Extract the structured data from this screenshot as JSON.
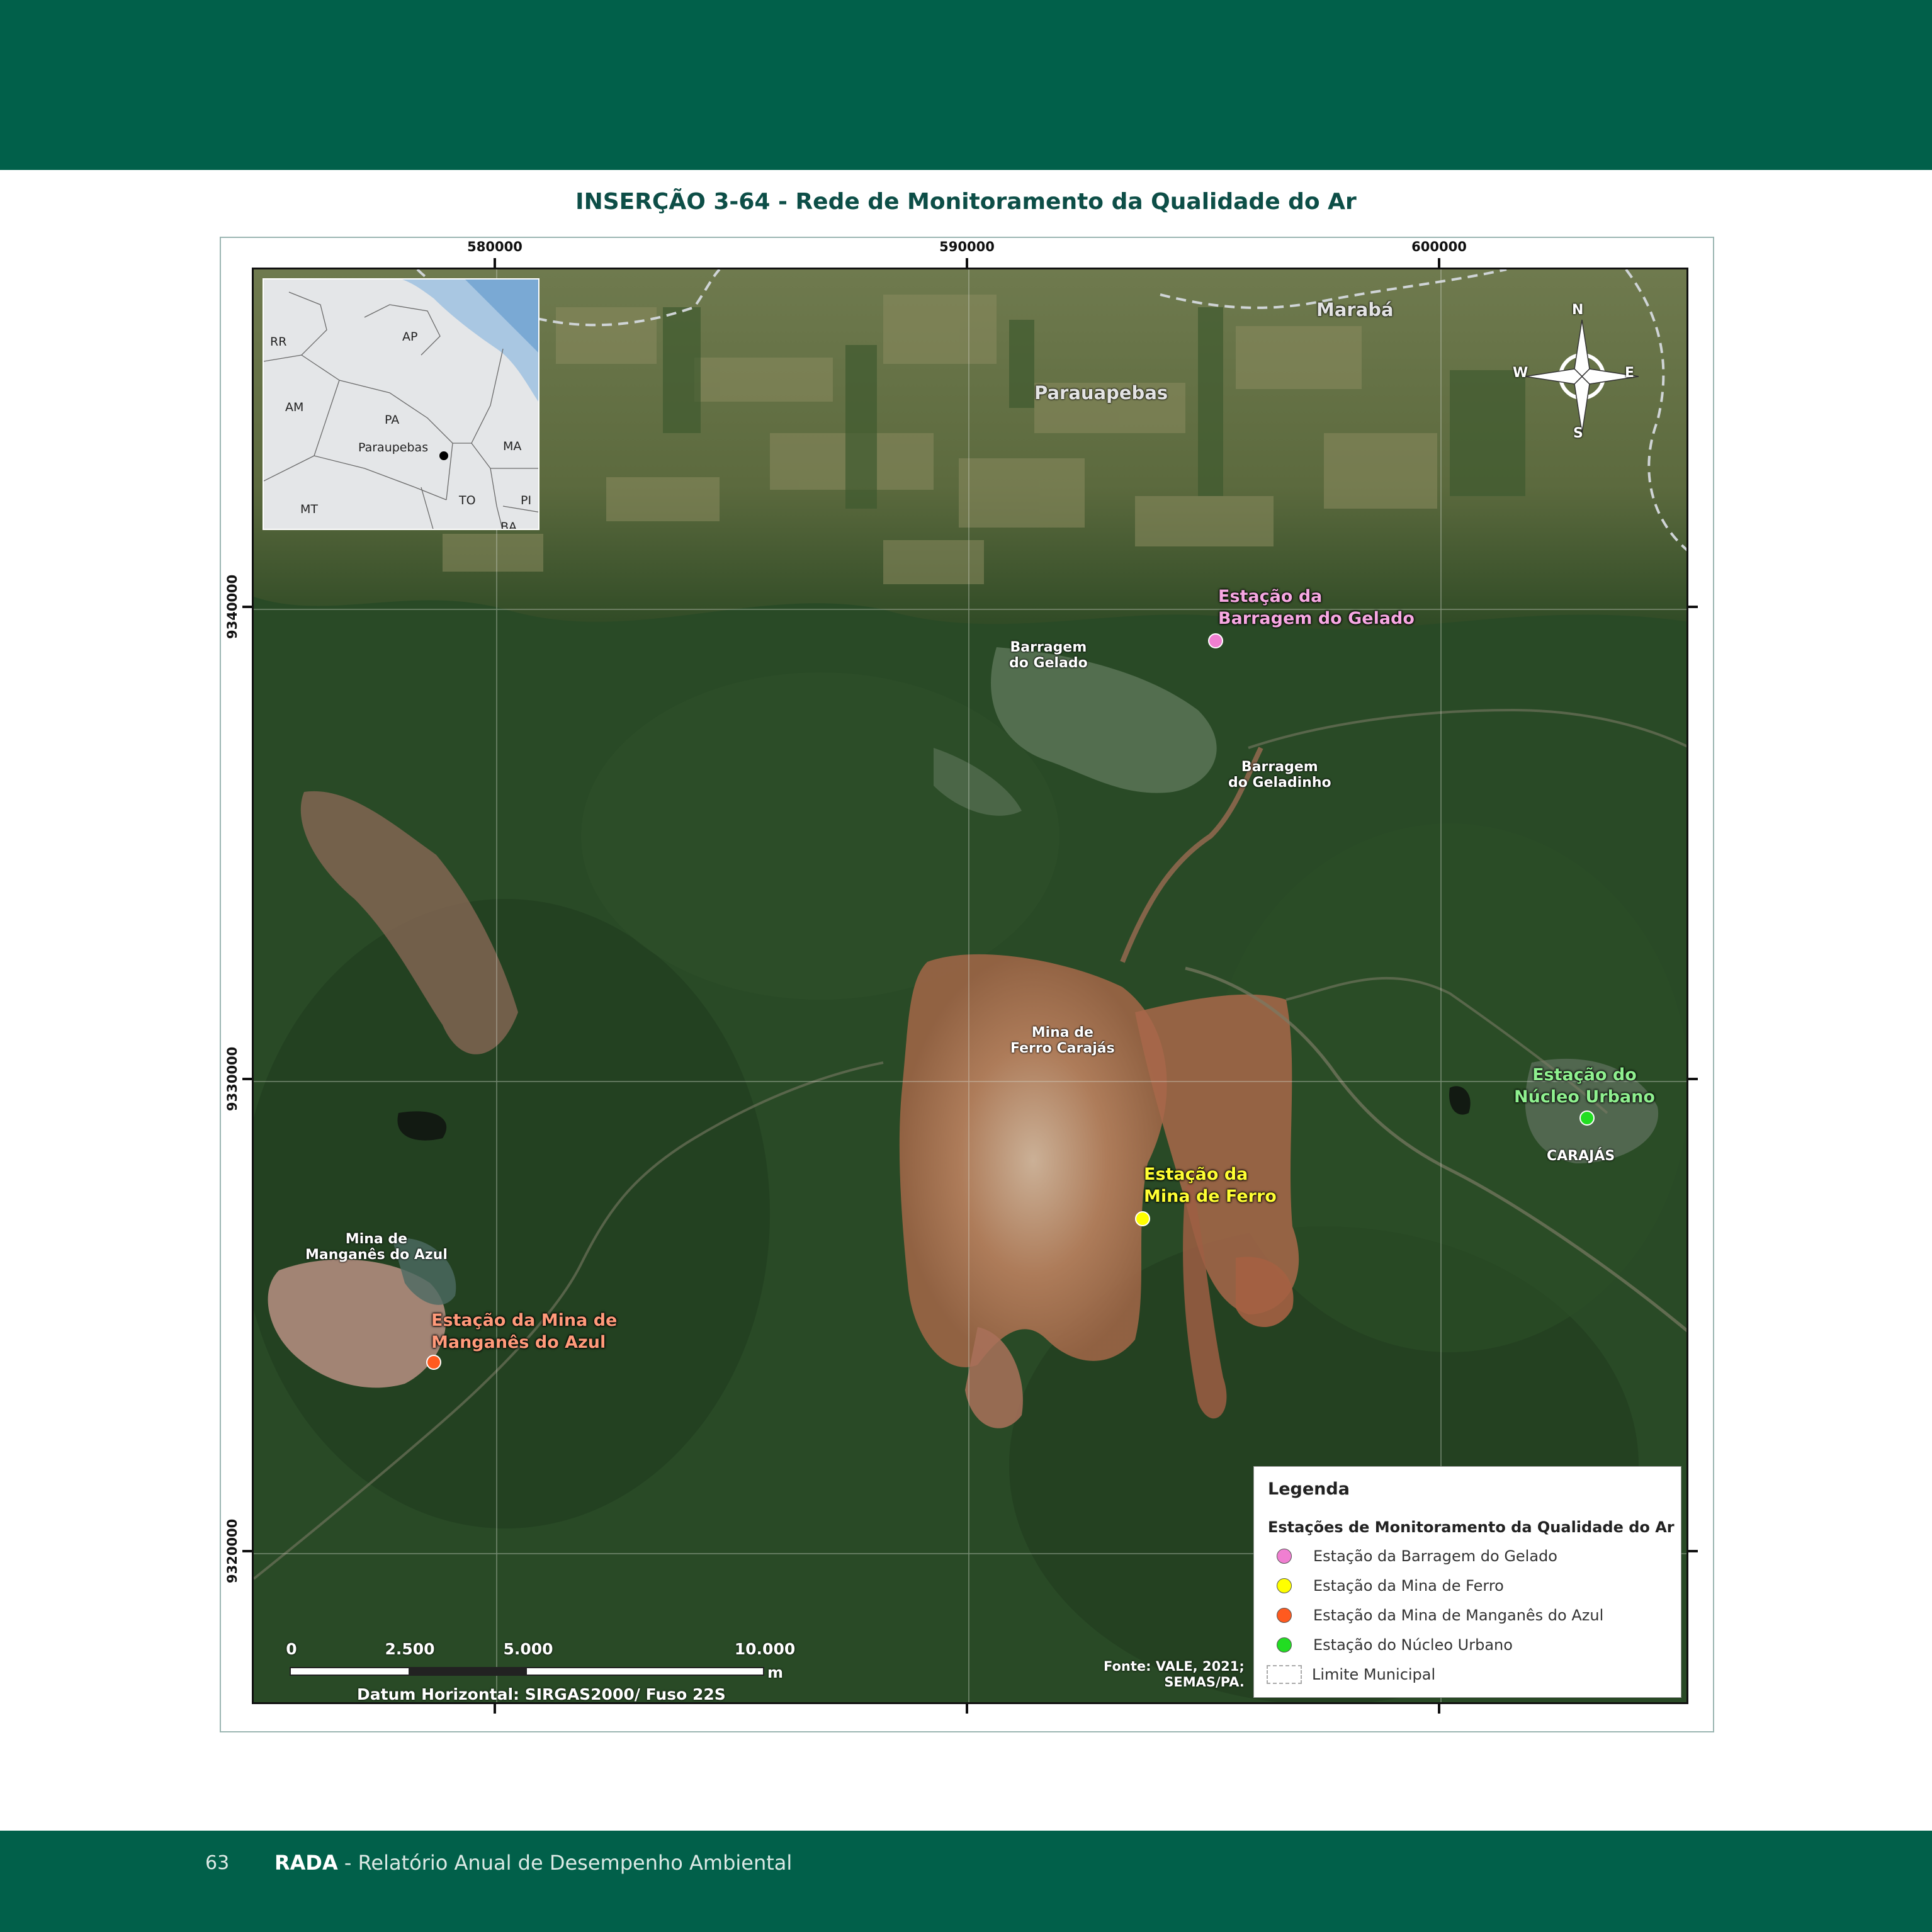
{
  "page": {
    "title": "INSERÇÃO 3-64 - Rede de Monitoramento da Qualidade do Ar",
    "page_number": "63",
    "footer_brand": "RADA",
    "footer_text": " - Relatório Anual de Desempenho Ambiental",
    "band_color": "#01604a"
  },
  "axes": {
    "x_ticks": [
      "580000",
      "590000",
      "600000"
    ],
    "y_ticks": [
      "9340000",
      "9330000",
      "9320000"
    ]
  },
  "places": {
    "maraba": "Marabá",
    "parauapebas": "Parauapebas",
    "barragem_gelado": [
      "Barragem",
      "do Gelado"
    ],
    "barragem_geladinho": [
      "Barragem",
      "do Geladinho"
    ],
    "mina_ferro": [
      "Mina de",
      "Ferro Carajás"
    ],
    "mina_manganes": [
      "Mina de",
      "Manganês do Azul"
    ],
    "carajas": "CARAJÁS"
  },
  "stations": {
    "gelado": {
      "line1": "Estação da",
      "line2": "Barragem do Gelado",
      "color": "#f07fd1"
    },
    "ferro": {
      "line1": "Estação da",
      "line2": "Mina de Ferro",
      "color": "#ffff00"
    },
    "manganes": {
      "line1": "Estação da Mina de",
      "line2": "Manganês do Azul",
      "color": "#ff5a1f"
    },
    "urbano": {
      "line1": "Estação do",
      "line2": "Núcleo Urbano",
      "color": "#22dd22"
    }
  },
  "compass": {
    "n": "N",
    "s": "S",
    "e": "E",
    "w": "W"
  },
  "inset": {
    "states": [
      "RR",
      "AP",
      "AM",
      "PA",
      "MA",
      "MT",
      "TO",
      "PI",
      "BA"
    ],
    "city": "Paraupebas"
  },
  "legend": {
    "title": "Legenda",
    "subtitle": "Estações de Monitoramento da Qualidade do Ar",
    "items": [
      {
        "label": "Estação da Barragem do Gelado",
        "color": "#f07fd1"
      },
      {
        "label": "Estação da Mina de Ferro",
        "color": "#ffff00"
      },
      {
        "label": "Estação da Mina de Manganês do Azul",
        "color": "#ff5a1f"
      },
      {
        "label": "Estação do Núcleo Urbano",
        "color": "#22dd22"
      },
      {
        "label": "Limite Municipal",
        "color": ""
      }
    ]
  },
  "scale": {
    "labels": [
      "0",
      "2.500",
      "5.000",
      "10.000"
    ],
    "unit": "m",
    "datum": "Datum Horizontal: SIRGAS2000/ Fuso 22S"
  },
  "source": {
    "line1": "Fonte: VALE, 2021;",
    "line2": "SEMAS/PA."
  }
}
